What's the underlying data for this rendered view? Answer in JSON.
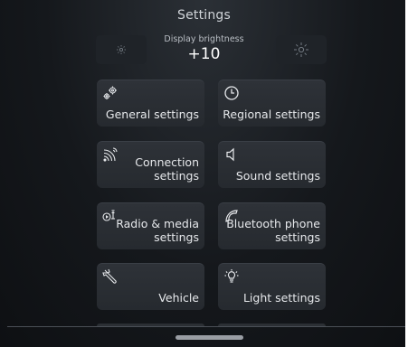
{
  "header": {
    "title": "Settings"
  },
  "brightness": {
    "label": "Display brightness",
    "value": "+10",
    "decrease_icon": "sun-dim-icon",
    "increase_icon": "sun-bright-icon"
  },
  "tiles": [
    {
      "label": "General settings",
      "icon": "gears-icon"
    },
    {
      "label": "Regional settings",
      "icon": "clock-icon"
    },
    {
      "label": "Connection\nsettings",
      "icon": "signal-waves-icon"
    },
    {
      "label": "Sound settings",
      "icon": "speaker-icon"
    },
    {
      "label": "Radio & media\nsettings",
      "icon": "radio-media-icon"
    },
    {
      "label": "Bluetooth phone\nsettings",
      "icon": "phone-icon"
    },
    {
      "label": "Vehicle",
      "icon": "wrench-icon"
    },
    {
      "label": "Light settings",
      "icon": "light-bulb-icon"
    }
  ]
}
